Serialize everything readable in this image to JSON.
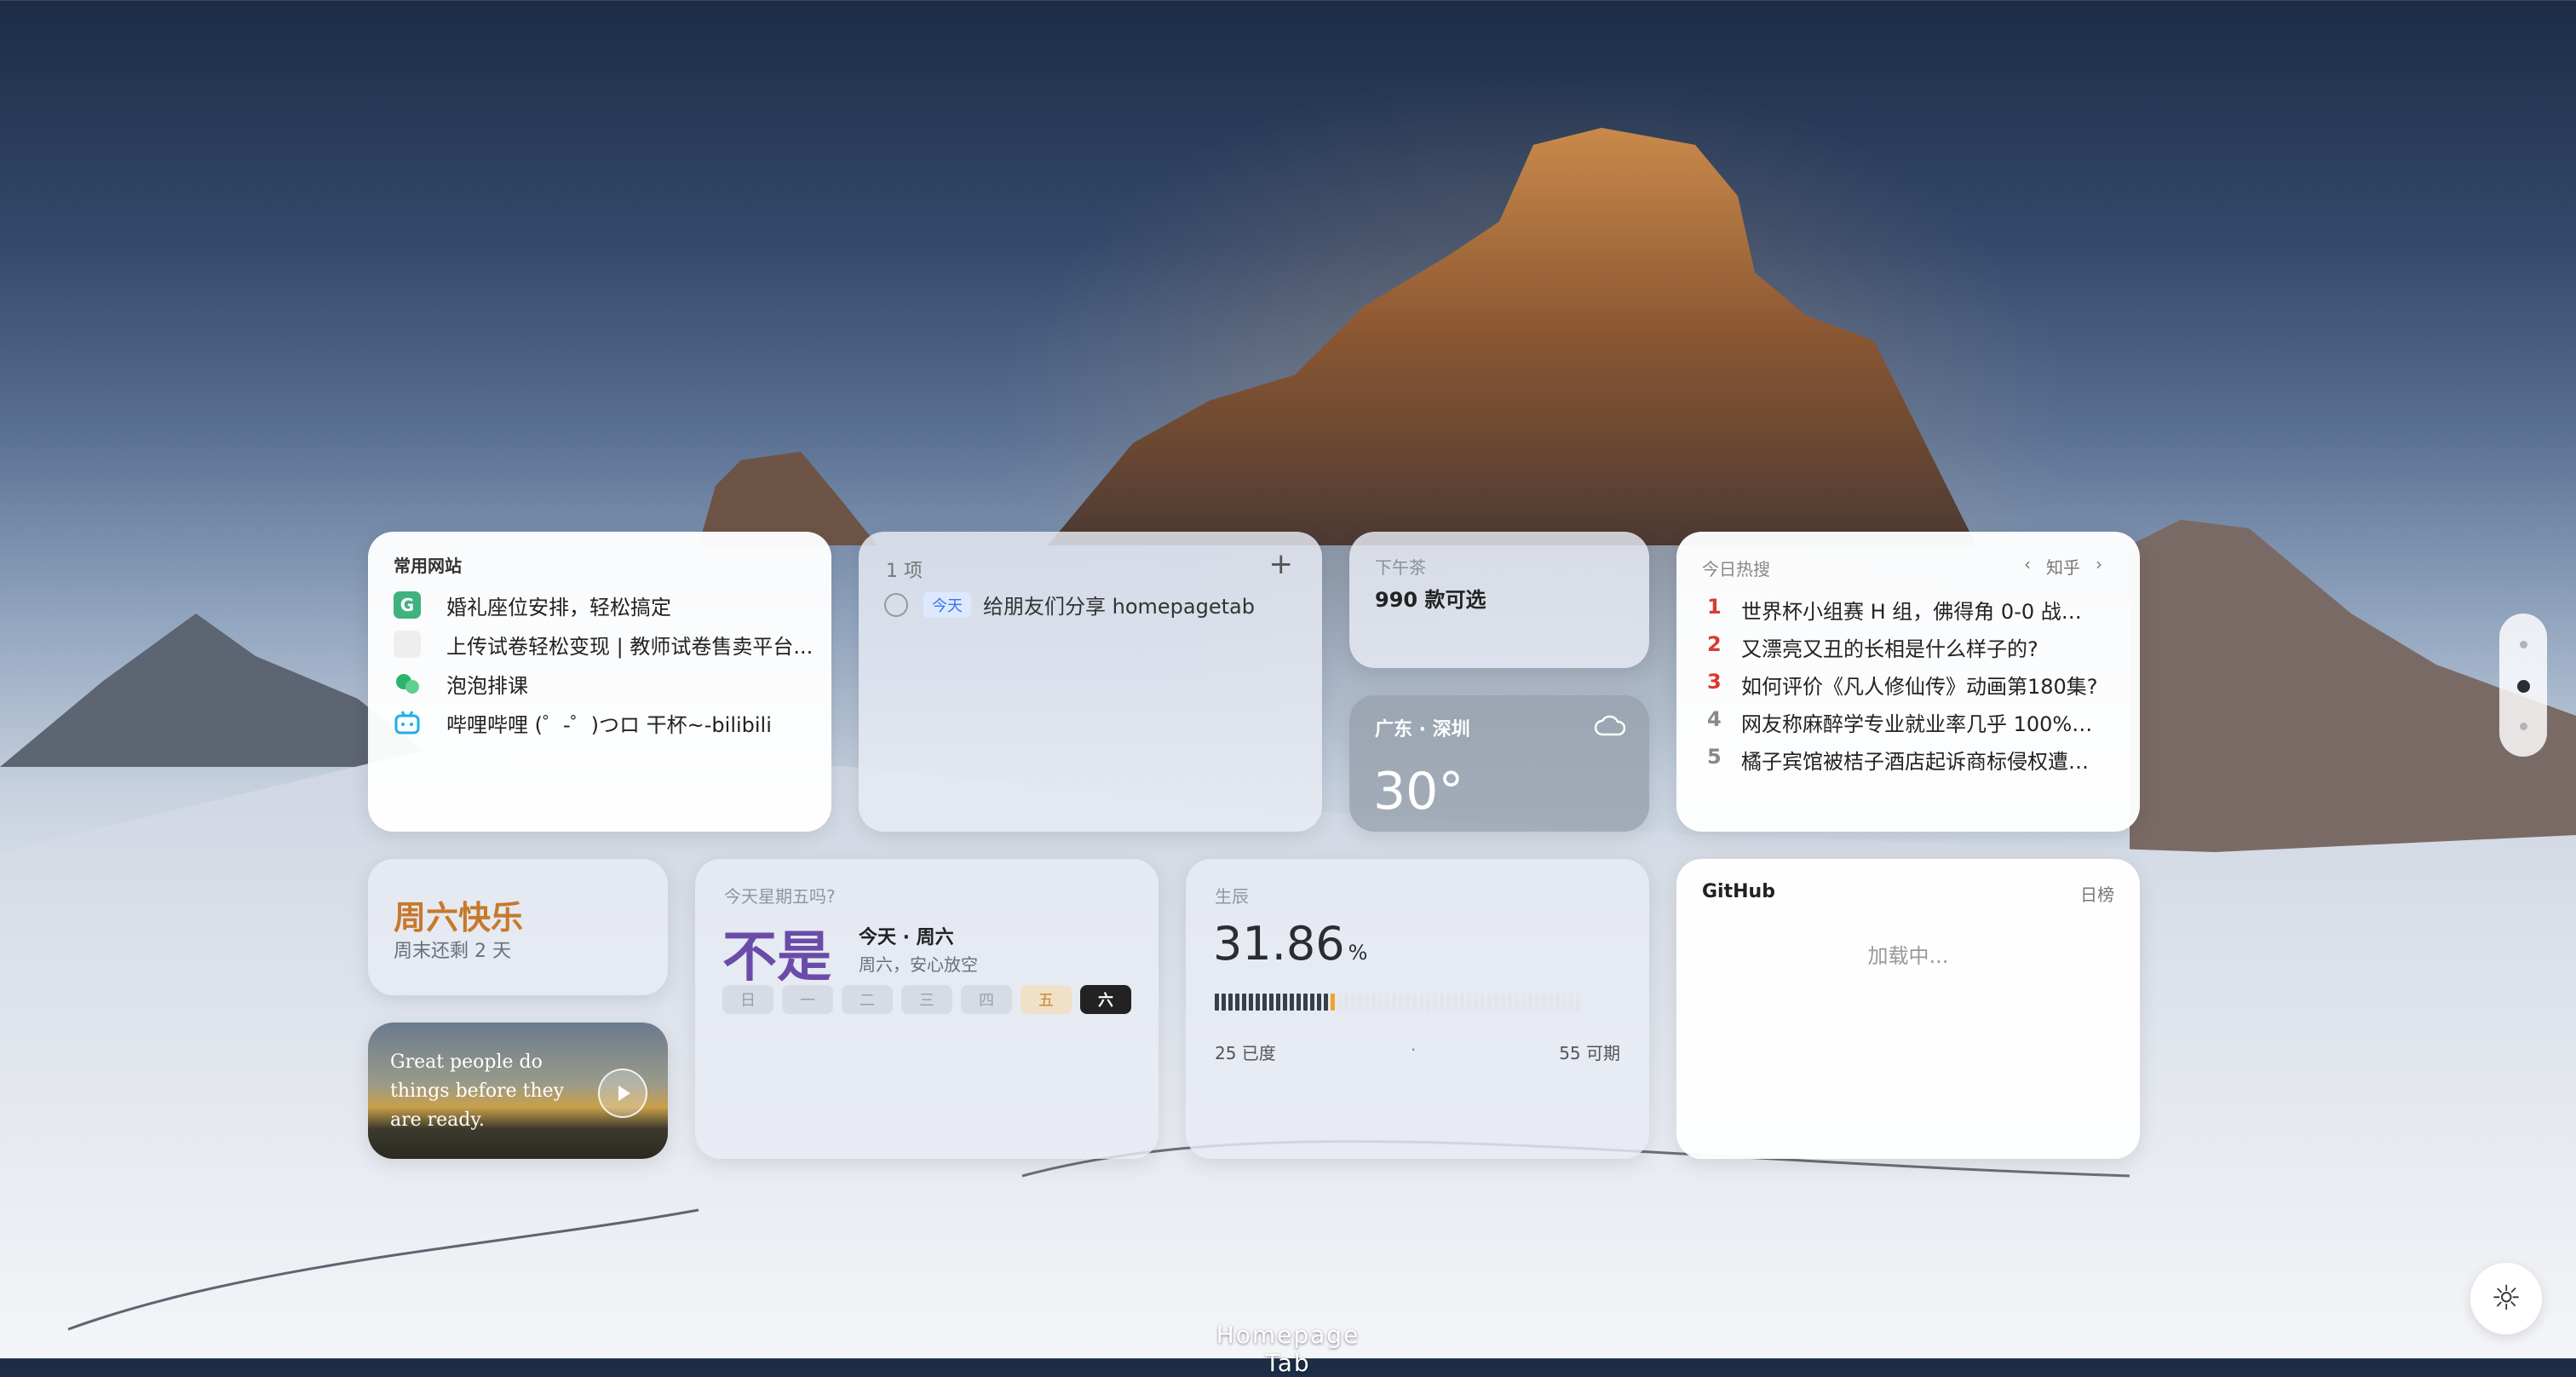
{
  "brand": "Homepage Tab",
  "sites": {
    "title": "常用网站",
    "items": [
      {
        "icon": "G",
        "icon_name": "gaoding-logo-icon",
        "color": "#3fb27f",
        "label": "婚礼座位安排，轻松搞定"
      },
      {
        "icon": "",
        "icon_name": "blank-site-icon",
        "color": "#eeeeee",
        "label": "上传试卷轻松变现 | 教师试卷售卖平台..."
      },
      {
        "icon": "",
        "icon_name": "paopao-logo-icon",
        "color": "#2db36e",
        "label": "泡泡排课"
      },
      {
        "icon": "",
        "icon_name": "bilibili-logo-icon",
        "color": "#23aee5",
        "label": "哔哩哔哩 (゜-゜)つロ 干杯~-bilibili"
      }
    ]
  },
  "todo": {
    "count": "1 项",
    "add": "+",
    "items": [
      {
        "tag": "今天",
        "text": "给朋友们分享 homepagetab"
      }
    ]
  },
  "tea": {
    "title": "下午茶",
    "subtitle": "990 款可选"
  },
  "weather": {
    "location": "广东 · 深圳",
    "temp": "30°",
    "icon": "cloud-icon"
  },
  "hot": {
    "title": "今日热搜",
    "source": "知乎",
    "prev": "‹",
    "next": "›",
    "rank_colors": [
      "#d93a2f",
      "#d93a2f",
      "#d93a2f",
      "#888888",
      "#888888"
    ],
    "items": [
      {
        "rank": "1",
        "title": "世界杯小组赛 H 组，佛得角 0-0 战平..."
      },
      {
        "rank": "2",
        "title": "又漂亮又丑的长相是什么样子的?"
      },
      {
        "rank": "3",
        "title": "如何评价《凡人修仙传》动画第180集?"
      },
      {
        "rank": "4",
        "title": "网友称麻醉学专业就业率几乎 100%，..."
      },
      {
        "rank": "5",
        "title": "橘子宾馆被桔子酒店起诉商标侵权遭索..."
      }
    ]
  },
  "weekend": {
    "title": "周六快乐",
    "subtitle": "周末还剩 2 天"
  },
  "quote": {
    "text": "Great people do things before they are ready."
  },
  "friday": {
    "question": "今天星期五吗?",
    "answer": "不是",
    "today": "今天 · 周六",
    "desc": "周六，安心放空",
    "days": [
      "日",
      "一",
      "二",
      "三",
      "四",
      "五",
      "六"
    ]
  },
  "life": {
    "title": "生辰",
    "percent": "31.86",
    "unit": "%",
    "progress": 0.3186,
    "total_segments": 54,
    "used_label": "25 已度",
    "sep": "·",
    "remaining_label": "55 可期"
  },
  "github": {
    "title": "GitHub",
    "tab": "日榜",
    "loading": "加载中..."
  },
  "pager": {
    "active": 1,
    "count": 3
  },
  "colors": {
    "friday_answer": "#6b4ba8",
    "weekend_title": "#c7792a",
    "accent": "#f1a32b"
  }
}
